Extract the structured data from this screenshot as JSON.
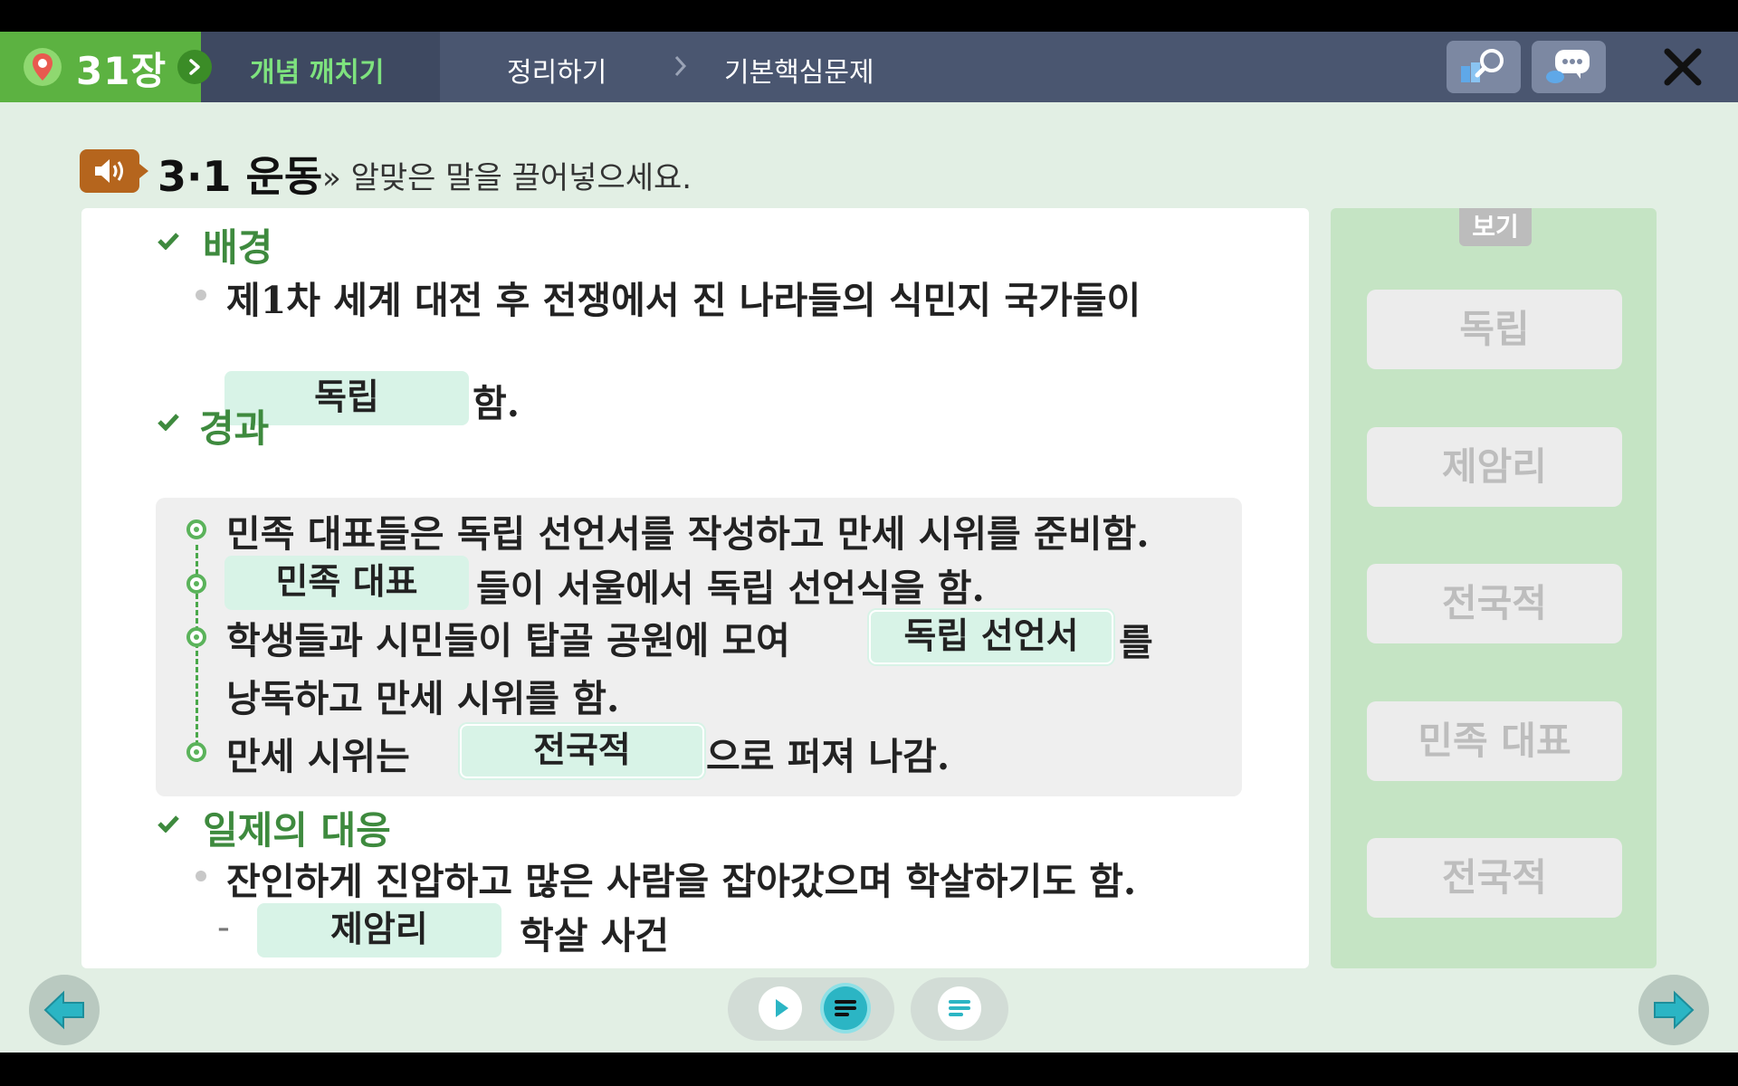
{
  "topbar": {
    "chapter": "31장",
    "steps": [
      "개념 깨치기",
      "정리하기",
      "기본핵심문제"
    ]
  },
  "header": {
    "title": "3·1 운동",
    "instruction": "» 알맞은 말을 끌어넣으세요."
  },
  "sections": {
    "background": {
      "title": "배경",
      "line1": "제1차 세계 대전 후 전쟁에서 진 나라들의 식민지 국가들이",
      "answer": "독립",
      "line2_suffix": "함."
    },
    "result": {
      "title": "경과",
      "item1": "민족 대표들은 독립 선언서를 작성하고 만세 시위를 준비함.",
      "item2_answer": "민족 대표",
      "item2_suffix": "들이 서울에서 독립 선언식을 함.",
      "item3_prefix": "학생들과 시민들이 탑골 공원에 모여",
      "item3_answer": "독립 선언서",
      "item3_suffix": "를",
      "item3_line2": "낭독하고 만세 시위를 함.",
      "item4_prefix": "만세 시위는",
      "item4_answer": "전국적",
      "item4_suffix": "으로 퍼져 나감."
    },
    "response": {
      "title": "일제의 대응",
      "line1": "잔인하게 진압하고 많은 사람을 잡아갔으며 학살하기도 함.",
      "dash": "-",
      "answer": "제암리",
      "suffix": "학살 사건"
    }
  },
  "word_bank": {
    "label": "보기",
    "words": [
      "독립",
      "제암리",
      "전국적",
      "민족 대표",
      "전국적"
    ]
  },
  "colors": {
    "accent_green": "#5cb241",
    "topbar": "#4a5670",
    "answer_bg": "#d8f3e7",
    "section_title": "#3e8a3e"
  }
}
